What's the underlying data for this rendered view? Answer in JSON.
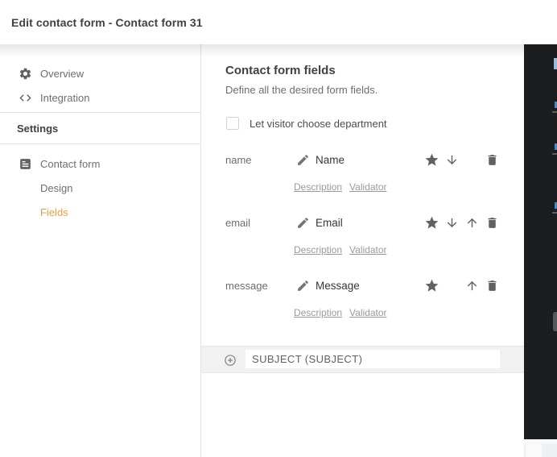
{
  "header": {
    "title": "Edit contact form - Contact form 31"
  },
  "sidebar": {
    "items": [
      {
        "label": "Overview",
        "icon": "gear-icon"
      },
      {
        "label": "Integration",
        "icon": "code-icon"
      }
    ],
    "section_label": "Settings",
    "settings_items": [
      {
        "label": "Contact form",
        "icon": "form-icon"
      },
      {
        "label": "Design"
      },
      {
        "label": "Fields",
        "active": true
      }
    ]
  },
  "main": {
    "title": "Contact form fields",
    "subtitle": "Define all the desired form fields.",
    "department_checkbox": {
      "label": "Let visitor choose department",
      "checked": false
    },
    "fields": [
      {
        "key": "name",
        "title": "Name",
        "links": [
          "Description",
          "Validator"
        ],
        "actions": {
          "star": true,
          "move_down": true,
          "move_up": false,
          "delete": true
        }
      },
      {
        "key": "email",
        "title": "Email",
        "links": [
          "Description",
          "Validator"
        ],
        "actions": {
          "star": true,
          "move_down": true,
          "move_up": true,
          "delete": true
        }
      },
      {
        "key": "message",
        "title": "Message",
        "links": [
          "Description",
          "Validator"
        ],
        "actions": {
          "star": true,
          "move_down": false,
          "move_up": true,
          "delete": true
        }
      }
    ],
    "add_field_bar": {
      "label": "SUBJECT (SUBJECT)",
      "icon": "plus-circle-icon"
    }
  },
  "colors": {
    "accent_orange": "#f29c43",
    "icon_gray": "#616161",
    "text_dark": "#3f4245",
    "text_muted": "#6d6d6d",
    "link_gray": "#9a9a9a",
    "backdrop_dark": "#1b1d1f",
    "bar_gray": "#f1f1f1"
  }
}
